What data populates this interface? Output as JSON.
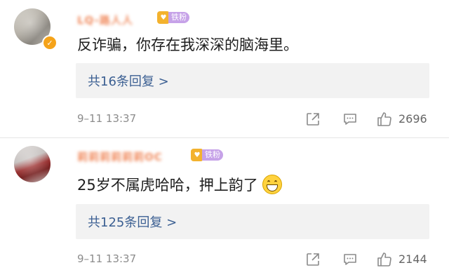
{
  "comments": [
    {
      "username": "LQ-路人人",
      "fan_badge": "铁粉",
      "text": "反诈骗，你存在我深深的脑海里。",
      "replies_label": "共16条回复 >",
      "date": "9–11 13:37",
      "likes": "2696"
    },
    {
      "username": "莉莉莉莉莉莉OC",
      "fan_badge": "铁粉",
      "text": "25岁不属虎哈哈，押上韵了",
      "replies_label": "共125条回复 >",
      "date": "9–11 13:37",
      "likes": "2144"
    }
  ],
  "icons": {
    "share": "share-icon",
    "reply": "comment-icon",
    "like": "thumbs-up-icon",
    "verified": "verified-badge-icon",
    "emoji": "grinning-emoji-icon"
  },
  "colors": {
    "link": "#3b5f92",
    "meta": "#8c8c8c",
    "badge": "#f5a31a"
  }
}
